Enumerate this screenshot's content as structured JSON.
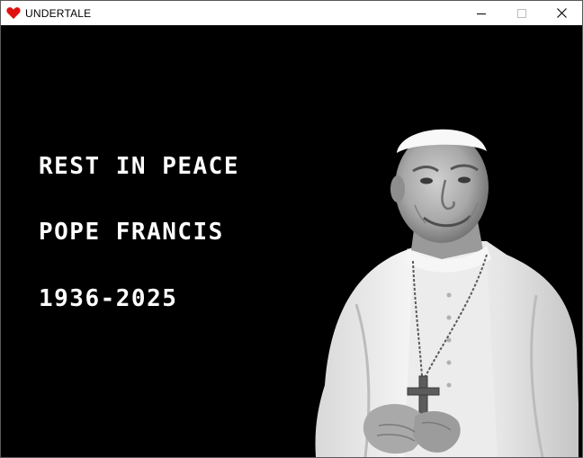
{
  "window": {
    "title": "UNDERTALE",
    "icon": "heart-icon",
    "controls": [
      "minimize-icon",
      "maximize-icon",
      "close-icon"
    ]
  },
  "screen": {
    "lines": [
      "REST IN PEACE",
      "POPE FRANCIS",
      "1936-2025"
    ]
  },
  "colors": {
    "background": "#000000",
    "text": "#ffffff",
    "heart": "#e01010",
    "titlebar": "#ffffff"
  }
}
